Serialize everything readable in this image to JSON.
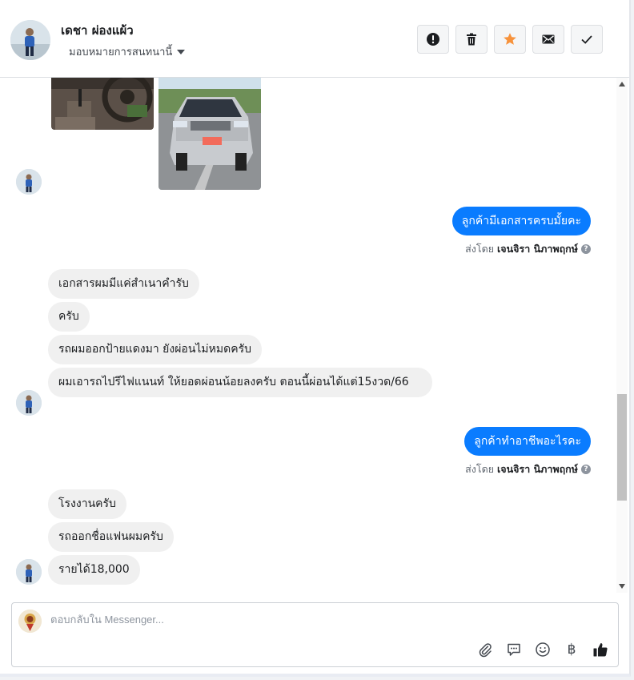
{
  "header": {
    "contact_name": "เดชา ผ่องแผ้ว",
    "assign_label": "มอบหมายการสนทนานี้",
    "actions": [
      {
        "icon": "alert-icon",
        "label": "mark-spam"
      },
      {
        "icon": "trash-icon",
        "label": "delete"
      },
      {
        "icon": "star-icon",
        "label": "follow-up"
      },
      {
        "icon": "envelope-icon",
        "label": "mark-unread"
      },
      {
        "icon": "check-icon",
        "label": "mark-done"
      }
    ]
  },
  "messages": {
    "out_1": "ลูกค้ามีเอกสารครบมั้ยคะ",
    "sent_by_prefix": "ส่งโดย",
    "agent_name": "เจนจิรา นิภาพฤกษ์",
    "in_1": "เอกสารผมมีแค่สำเนาคำรับ",
    "in_2": "ครับ",
    "in_3": "รถผมออกป้ายแดงมา ยังผ่อนไม่หมดครับ",
    "in_4": "ผมเอารถไปรีไฟแนนท์ ให้ยอดผ่อนน้อยลงครับ  ตอนนี้ผ่อนได้แต่15งวด/66",
    "out_2": "ลูกค้าทำอาชีพอะไรคะ",
    "in_5": "โรงงานครับ",
    "in_6": "รถออกชื่อแฟนผมครับ",
    "in_7": "รายได้18,000"
  },
  "composer": {
    "placeholder": "ตอบกลับใน Messenger...",
    "currency_symbol": "฿"
  },
  "colors": {
    "outgoing_bubble": "#0a7cff",
    "incoming_bubble": "#f0f0f0",
    "star": "#f7923b"
  }
}
